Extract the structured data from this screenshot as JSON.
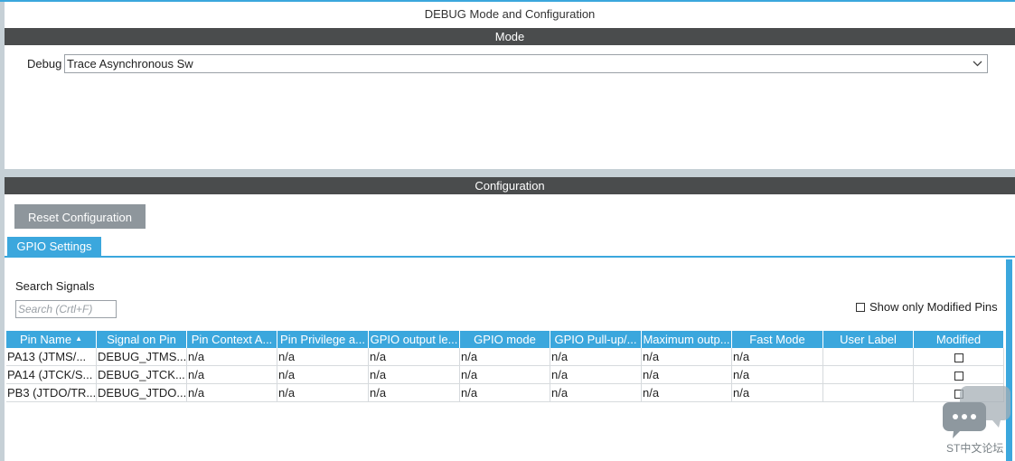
{
  "window": {
    "title": "DEBUG Mode and Configuration"
  },
  "mode": {
    "header": "Mode",
    "debug_label": "Debug",
    "debug_value": "Trace Asynchronous Sw"
  },
  "configuration": {
    "header": "Configuration",
    "reset_button": "Reset Configuration",
    "tabs": [
      {
        "label": "GPIO Settings",
        "active": true
      }
    ],
    "search_label": "Search Signals",
    "search_placeholder": "Search (Crtl+F)",
    "show_modified_label": "Show only Modified Pins",
    "show_modified_checked": false,
    "table": {
      "columns": [
        "Pin Name",
        "Signal on Pin",
        "Pin Context A...",
        "Pin Privilege a...",
        "GPIO output le...",
        "GPIO mode",
        "GPIO Pull-up/...",
        "Maximum outp...",
        "Fast Mode",
        "User Label",
        "Modified"
      ],
      "rows": [
        {
          "cells": [
            "PA13 (JTMS/...",
            "DEBUG_JTMS...",
            "n/a",
            "n/a",
            "n/a",
            "n/a",
            "n/a",
            "n/a",
            "n/a",
            ""
          ],
          "modified": false
        },
        {
          "cells": [
            "PA14 (JTCK/S...",
            "DEBUG_JTCK...",
            "n/a",
            "n/a",
            "n/a",
            "n/a",
            "n/a",
            "n/a",
            "n/a",
            ""
          ],
          "modified": false
        },
        {
          "cells": [
            "PB3 (JTDO/TR...",
            "DEBUG_JTDO...",
            "n/a",
            "n/a",
            "n/a",
            "n/a",
            "n/a",
            "n/a",
            "n/a",
            ""
          ],
          "modified": false
        }
      ]
    }
  },
  "watermark": {
    "text": "ST中文论坛"
  },
  "colors": {
    "accent": "#3ba7dd",
    "section_bar": "#4a4c4d",
    "button": "#8e969c"
  }
}
